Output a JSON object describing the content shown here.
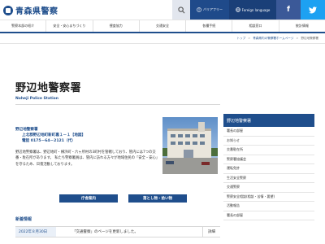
{
  "header": {
    "logo_text": "青森県警察",
    "barrier_free_label": "バリアフリー",
    "language_label": "Foreign language",
    "facebook_label": "f"
  },
  "nav": {
    "items": [
      "警察本部の紹介",
      "安全・安心まちづくり",
      "捜査協力",
      "交通安全",
      "各種手続",
      "相談窓口",
      "統計情報"
    ]
  },
  "breadcrumb": {
    "items": [
      "トップ",
      "青森県内の警察署ホームページ",
      "野辺地警察署"
    ]
  },
  "page": {
    "title": "野辺地警察署",
    "subtitle": "Noheji Police Station"
  },
  "info": {
    "name": "野辺地警察署",
    "address": "上北郡野辺地町新町裏１－１【地図】",
    "tel": "電話 0175－64－2121（代）",
    "description": "野辺地警察署は、野辺地町・横浜町・六ヶ所村の3町村を管轄しており、管内には7つの交番・駐在所があります。 私たち警察署員は、管内に訪れる方々が地域住民の「安全・安心」を守るため、日夜活動しております。"
  },
  "buttons": {
    "access": "庁舎案内",
    "lost": "落とし物・拾い物"
  },
  "news": {
    "title": "新着情報",
    "items": [
      {
        "date": "2022年８月30日",
        "text": "「交通警察」のページを更新しました。",
        "detail": "詳細"
      }
    ]
  },
  "sidebar": {
    "title": "野辺地警察署",
    "items": [
      "署長の部屋",
      "お知らせ",
      "交番駐在所",
      "警察署協議会",
      "運転免許",
      "生活安全警察",
      "交通警察",
      "警察安全相談(相談・苦情・要望)",
      "活動報告",
      "署長の部屋"
    ]
  },
  "colors": {
    "brand": "#1f4e8c",
    "facebook": "#3b5998",
    "twitter": "#1da1f2"
  }
}
